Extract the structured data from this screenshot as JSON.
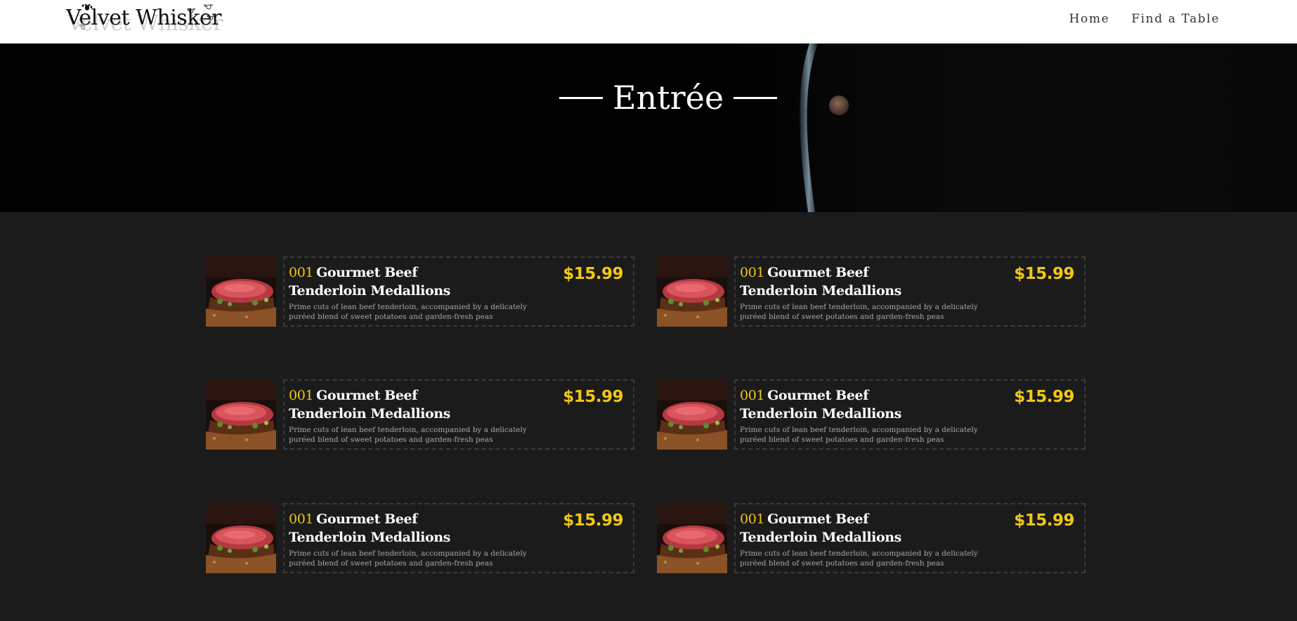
{
  "brand": {
    "name": "Velvet Whisker"
  },
  "nav": {
    "items": [
      {
        "label": "Home"
      },
      {
        "label": "Find a Table"
      }
    ]
  },
  "hero": {
    "title": "Entrée"
  },
  "menu": {
    "items": [
      {
        "number": "001",
        "name": "Gourmet Beef Tenderloin Medallions",
        "description": "Prime cuts of lean beef tenderloin, accompanied by a delicately puréed blend of sweet potatoes and garden-fresh peas",
        "price": "$15.99",
        "image": "steak-photo"
      },
      {
        "number": "001",
        "name": "Gourmet Beef Tenderloin Medallions",
        "description": "Prime cuts of lean beef tenderloin, accompanied by a delicately puréed blend of sweet potatoes and garden-fresh peas",
        "price": "$15.99",
        "image": "steak-photo"
      },
      {
        "number": "001",
        "name": "Gourmet Beef Tenderloin Medallions",
        "description": "Prime cuts of lean beef tenderloin, accompanied by a delicately puréed blend of sweet potatoes and garden-fresh peas",
        "price": "$15.99",
        "image": "steak-photo"
      },
      {
        "number": "001",
        "name": "Gourmet Beef Tenderloin Medallions",
        "description": "Prime cuts of lean beef tenderloin, accompanied by a delicately puréed blend of sweet potatoes and garden-fresh peas",
        "price": "$15.99",
        "image": "steak-photo"
      },
      {
        "number": "001",
        "name": "Gourmet Beef Tenderloin Medallions",
        "description": "Prime cuts of lean beef tenderloin, accompanied by a delicately puréed blend of sweet potatoes and garden-fresh peas",
        "price": "$15.99",
        "image": "steak-photo"
      },
      {
        "number": "001",
        "name": "Gourmet Beef Tenderloin Medallions",
        "description": "Prime cuts of lean beef tenderloin, accompanied by a delicately puréed blend of sweet potatoes and garden-fresh peas",
        "price": "$15.99",
        "image": "steak-photo"
      }
    ]
  },
  "colors": {
    "accent": "#f2c811",
    "page_background": "#1b1b1b",
    "header_background": "#ffffff",
    "hero_background": "#000000",
    "card_border": "#3a3a3a"
  }
}
